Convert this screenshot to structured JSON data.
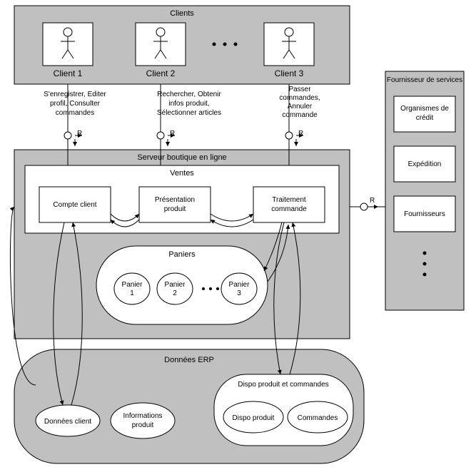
{
  "clients": {
    "title": "Clients",
    "actors": [
      "Client 1",
      "Client 2",
      "Client 3"
    ]
  },
  "messages": {
    "m1": {
      "line1": "S'enregistrer, Editer",
      "line2": "profil, Consulter",
      "line3": "commandes"
    },
    "m2": {
      "line1": "Rechercher, Obtenir",
      "line2": "infos produit,",
      "line3": "Sélectionner articles"
    },
    "m3": {
      "line1": "Passer",
      "line2": "commandes,",
      "line3": "Annuler",
      "line4": "commande"
    }
  },
  "server": {
    "title": "Serveur boutique en ligne",
    "sales": {
      "title": "Ventes",
      "components": [
        "Compte client",
        "Présentation produit",
        "Traitement commande"
      ]
    },
    "carts": {
      "title": "Paniers",
      "items": [
        "Panier 1",
        "Panier 2",
        "Panier 3"
      ]
    }
  },
  "erp": {
    "title": "Données ERP",
    "client_data": "Données client",
    "product_info": "Informations produit",
    "dispo_group": {
      "title": "Dispo produit et commandes",
      "dispo": "Dispo produit",
      "orders": "Commandes"
    }
  },
  "providers": {
    "title": "Fournisseur de services",
    "items": [
      "Organismes de crédit",
      "Expédition",
      "Fournisseurs"
    ]
  },
  "r_label": "R"
}
